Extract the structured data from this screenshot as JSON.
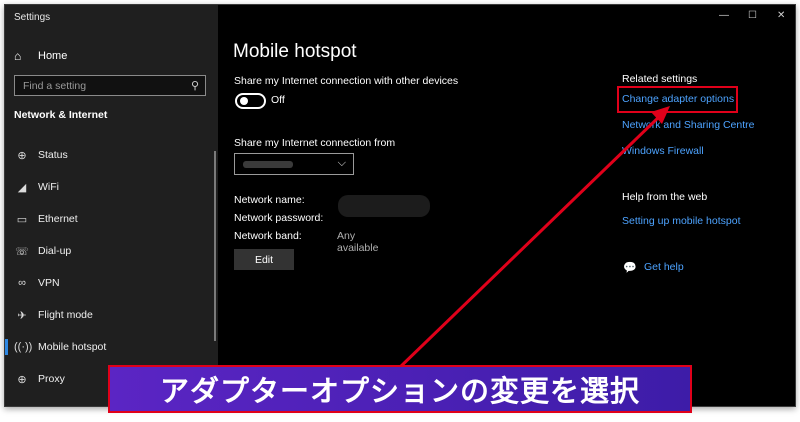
{
  "window": {
    "title": "Settings",
    "controls": {
      "minimize": "—",
      "maximize": "☐",
      "close": "✕"
    }
  },
  "sidebar": {
    "home": {
      "icon": "home-icon",
      "label": "Home"
    },
    "search": {
      "placeholder": "Find a setting",
      "icon": "search-icon"
    },
    "section_title": "Network & Internet",
    "items": [
      {
        "icon": "globe-icon",
        "label": "Status",
        "active": false
      },
      {
        "icon": "wifi-icon",
        "label": "WiFi",
        "active": false
      },
      {
        "icon": "ethernet-icon",
        "label": "Ethernet",
        "active": false
      },
      {
        "icon": "phone-icon",
        "label": "Dial-up",
        "active": false
      },
      {
        "icon": "vpn-icon",
        "label": "VPN",
        "active": false
      },
      {
        "icon": "plane-icon",
        "label": "Flight mode",
        "active": false
      },
      {
        "icon": "hotspot-icon",
        "label": "Mobile hotspot",
        "active": true
      },
      {
        "icon": "proxy-globe-icon",
        "label": "Proxy",
        "active": false
      }
    ]
  },
  "main": {
    "title": "Mobile hotspot",
    "share_label": "Share my Internet connection with other devices",
    "toggle_state": "Off",
    "share_from_label": "Share my Internet connection from",
    "network_name_label": "Network name:",
    "network_password_label": "Network password:",
    "network_band_label": "Network band:",
    "network_band_value": "Any available",
    "edit_label": "Edit"
  },
  "related": {
    "heading": "Related settings",
    "links": [
      "Change adapter options",
      "Network and Sharing Centre",
      "Windows Firewall"
    ],
    "help_heading": "Help from the web",
    "help_link": "Setting up mobile hotspot",
    "get_help": "Get help"
  },
  "banner": {
    "text": "アダプターオプションの変更を選択"
  },
  "colors": {
    "accent": "#2d87e2",
    "link": "#4da3ff",
    "highlight": "#e0001a",
    "banner_start": "#5b25c4",
    "banner_end": "#3d1ca8"
  }
}
